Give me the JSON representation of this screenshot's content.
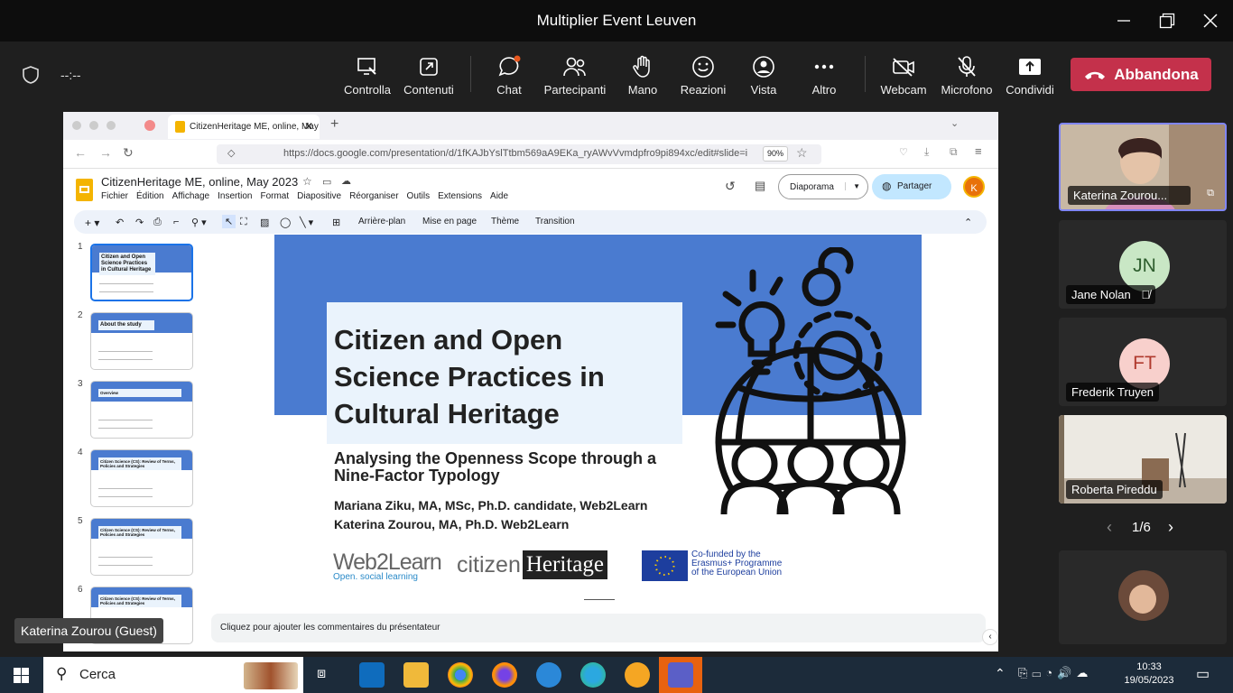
{
  "window": {
    "title": "Multiplier Event Leuven"
  },
  "toolbar": {
    "timer": "--:--",
    "items": [
      {
        "label": "Controlla",
        "icon": "control-icon"
      },
      {
        "label": "Contenuti",
        "icon": "share-content-icon"
      },
      {
        "label": "Chat",
        "icon": "chat-icon"
      },
      {
        "label": "Partecipanti",
        "icon": "participants-icon"
      },
      {
        "label": "Mano",
        "icon": "raise-hand-icon"
      },
      {
        "label": "Reazioni",
        "icon": "reactions-icon"
      },
      {
        "label": "Vista",
        "icon": "view-icon"
      },
      {
        "label": "Altro",
        "icon": "more-icon"
      },
      {
        "label": "Webcam",
        "icon": "camera-off-icon"
      },
      {
        "label": "Microfono",
        "icon": "mic-off-icon"
      },
      {
        "label": "Condividi",
        "icon": "share-icon"
      }
    ],
    "leave_label": "Abbandona"
  },
  "browser": {
    "tab_title": "CitizenHeritage ME, online, May",
    "url": "https://docs.google.com/presentation/d/1fKAJbYslTtbm569aA9EKa_ryAWvVvmdpfro9pi894xc/edit#slide=i",
    "zoom": "90%"
  },
  "docs": {
    "doc_title": "CitizenHeritage ME, online, May 2023",
    "menu": [
      "Fichier",
      "Édition",
      "Affichage",
      "Insertion",
      "Format",
      "Diapositive",
      "Réorganiser",
      "Outils",
      "Extensions",
      "Aide"
    ],
    "slideshow_label": "Diaporama",
    "share_label": "Partager",
    "avatar": "K",
    "edit_toolbar": [
      "Arrière-plan",
      "Mise en page",
      "Thème",
      "Transition"
    ],
    "notes_placeholder": "Cliquez pour ajouter les commentaires du présentateur",
    "thumbs": [
      {
        "num": "1",
        "title": "Citizen and Open Science Practices in Cultural Heritage"
      },
      {
        "num": "2",
        "title": "About the study"
      },
      {
        "num": "3",
        "title": "Overview"
      },
      {
        "num": "4",
        "title": "Citizen Science (CS): Review of Terms, Policies and Strategies"
      },
      {
        "num": "5",
        "title": "Citizen Science (CS): Review of Terms, Policies and Strategies"
      },
      {
        "num": "6",
        "title": "Citizen Science (CS): Review of Terms, Policies and Strategies"
      }
    ]
  },
  "slide": {
    "title_lines": [
      "Citizen and Open",
      "Science Practices in",
      "Cultural Heritage"
    ],
    "subtitle": "Analysing the Openness Scope through a Nine-Factor Typology",
    "author1": "Mariana Ziku, MA, MSc, Ph.D. candidate, Web2Learn",
    "author2": "Katerina Zourou, MA, Ph.D. Web2Learn",
    "logo_web2learn": "Web2Learn",
    "logo_web2learn_tag": "Open. social learning",
    "logo_citizen": "citizen",
    "logo_heritage": "Heritage",
    "eu_text": "Co-funded by the Erasmus+ Programme of the European Union"
  },
  "participants": {
    "tiles": [
      {
        "name": "Katerina Zourou..."
      },
      {
        "name": "Jane Nolan",
        "initials": "JN",
        "color": "#c9e7c5",
        "text_color": "#2e5e2e"
      },
      {
        "name": "Frederik Truyen",
        "initials": "FT",
        "color": "#f8d0cc",
        "text_color": "#b03a2e"
      },
      {
        "name": "Roberta Pireddu"
      }
    ],
    "pager": "1/6"
  },
  "guest_label": "Katerina Zourou (Guest)",
  "taskbar": {
    "search": "Cerca",
    "time": "10:33",
    "date": "19/05/2023"
  }
}
